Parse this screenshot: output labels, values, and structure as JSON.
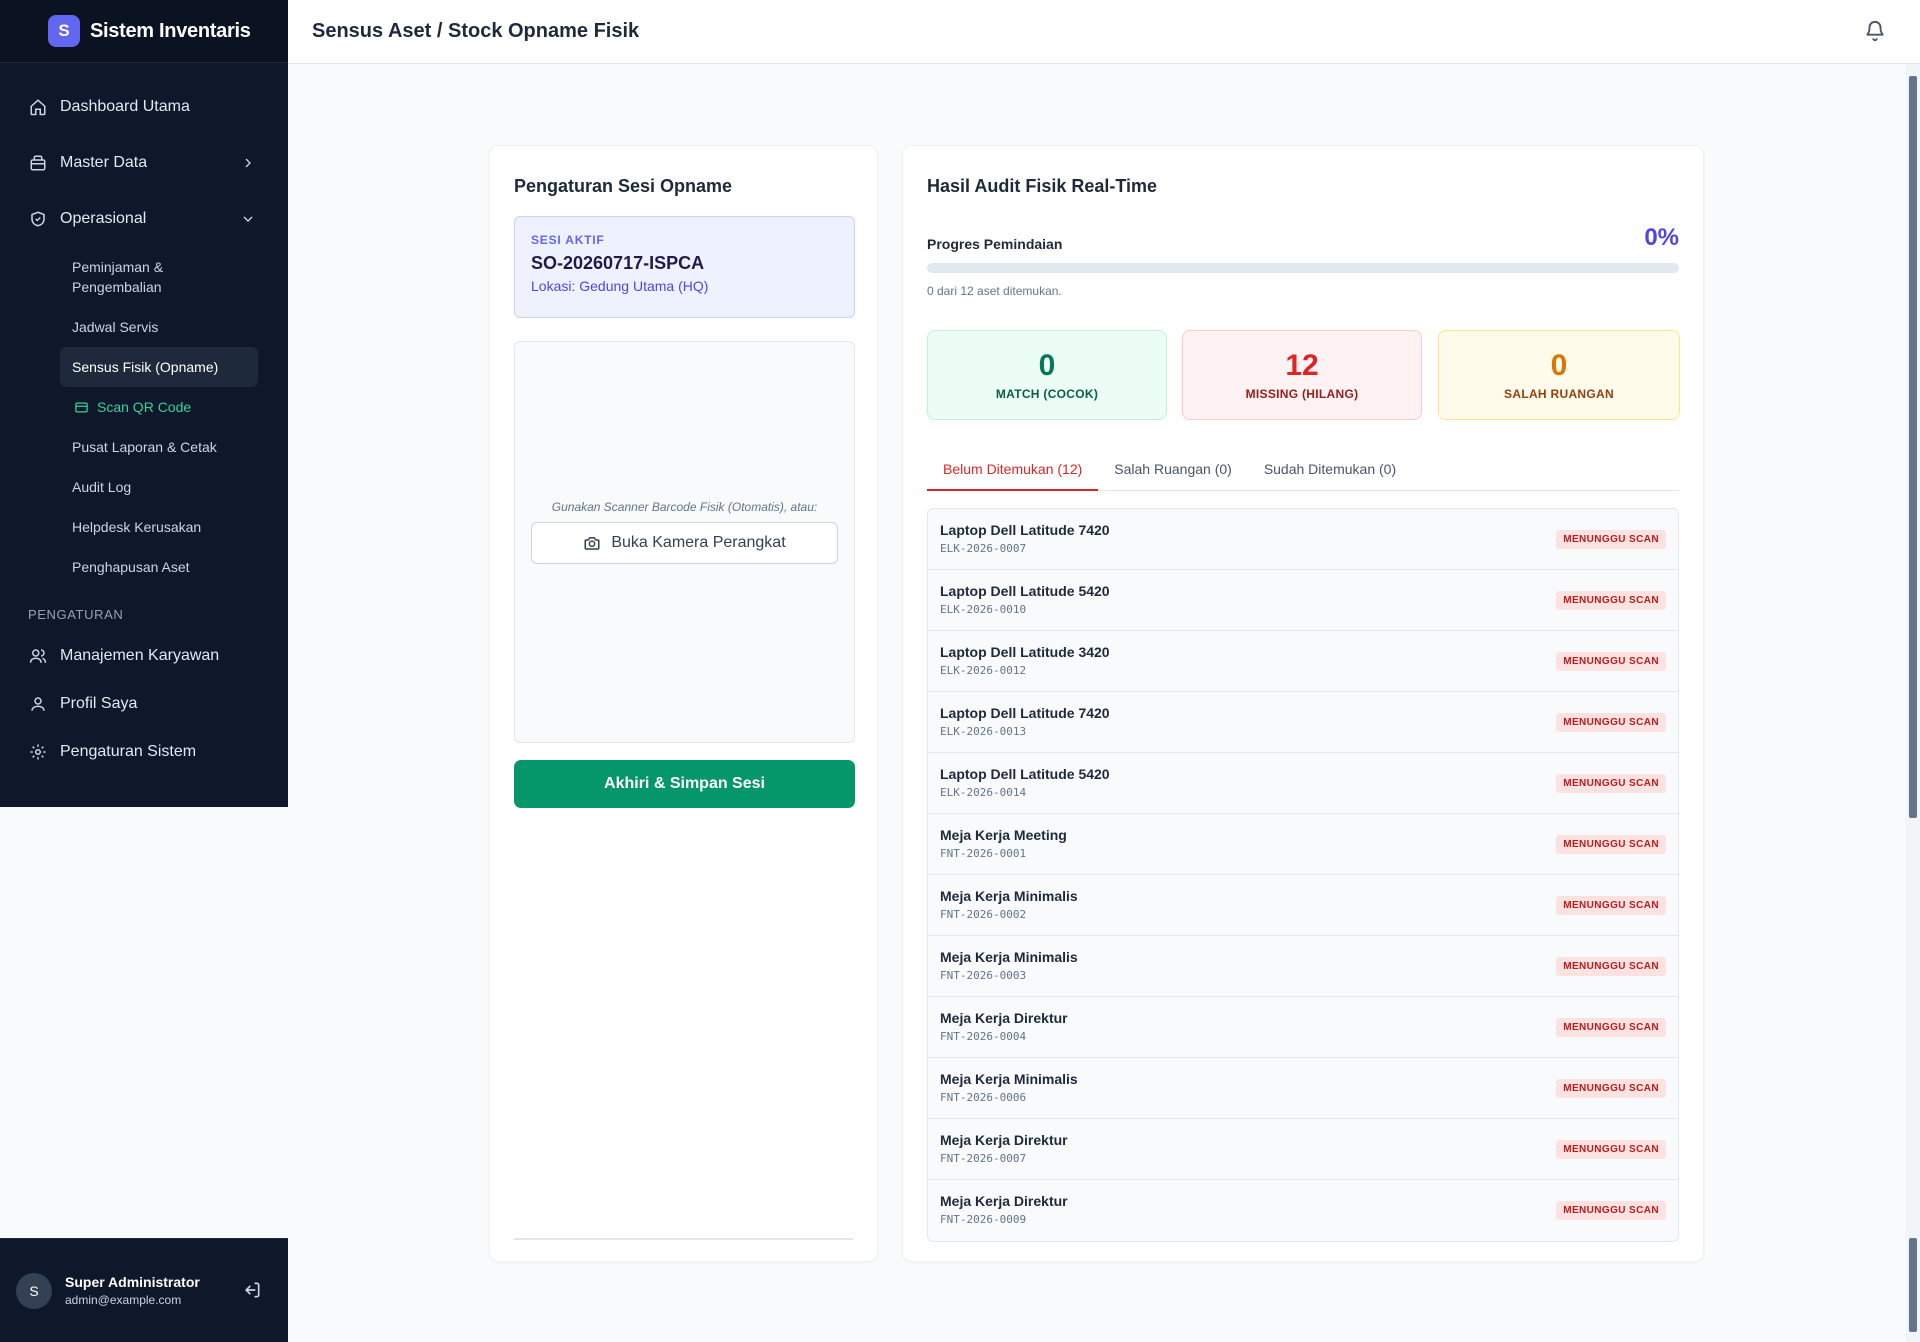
{
  "brand": {
    "logo": "S",
    "name": "Sistem Inventaris"
  },
  "header": {
    "title": "Sensus Aset / Stock Opname Fisik"
  },
  "sidebar": {
    "items": [
      {
        "label": "Dashboard Utama",
        "icon": "home-icon"
      },
      {
        "label": "Master Data",
        "icon": "box-icon"
      },
      {
        "label": "Operasional",
        "icon": "shield-icon"
      }
    ],
    "sub_items": [
      "Peminjaman & Pengembalian",
      "Jadwal Servis",
      "Sensus Fisik (Opname)",
      "Scan QR Code",
      "Pusat Laporan & Cetak",
      "Audit Log",
      "Helpdesk Kerusakan",
      "Penghapusan Aset"
    ],
    "section_label": "PENGATURAN",
    "settings_items": [
      {
        "label": "Manajemen Karyawan",
        "icon": "users-icon"
      },
      {
        "label": "Profil Saya",
        "icon": "user-icon"
      },
      {
        "label": "Pengaturan Sistem",
        "icon": "gear-icon"
      }
    ]
  },
  "user": {
    "initial": "S",
    "name": "Super Administrator",
    "email": "admin@example.com"
  },
  "left_card": {
    "title": "Pengaturan Sesi Opname",
    "session_label": "SESI AKTIF",
    "session_code": "SO-20260717-ISPCA",
    "session_location": "Lokasi: Gedung Utama (HQ)",
    "scanner_hint": "Gunakan Scanner Barcode Fisik (Otomatis), atau:",
    "camera_button": "Buka Kamera Perangkat",
    "save_button": "Akhiri & Simpan Sesi"
  },
  "right_card": {
    "title": "Hasil Audit Fisik Real-Time",
    "progress_label": "Progres Pemindaian",
    "progress_percent": "0%",
    "progress_value": 0,
    "progress_note": "0 dari 12 aset ditemukan.",
    "stats": {
      "match": {
        "value": "0",
        "label": "MATCH (COCOK)"
      },
      "missing": {
        "value": "12",
        "label": "MISSING (HILANG)"
      },
      "wrong": {
        "value": "0",
        "label": "SALAH RUANGAN"
      }
    },
    "tabs": [
      "Belum Ditemukan (12)",
      "Salah Ruangan (0)",
      "Sudah Ditemukan (0)"
    ],
    "assets": [
      {
        "name": "Laptop Dell Latitude 7420",
        "code": "ELK-2026-0007",
        "status": "MENUNGGU SCAN"
      },
      {
        "name": "Laptop Dell Latitude 5420",
        "code": "ELK-2026-0010",
        "status": "MENUNGGU SCAN"
      },
      {
        "name": "Laptop Dell Latitude 3420",
        "code": "ELK-2026-0012",
        "status": "MENUNGGU SCAN"
      },
      {
        "name": "Laptop Dell Latitude 7420",
        "code": "ELK-2026-0013",
        "status": "MENUNGGU SCAN"
      },
      {
        "name": "Laptop Dell Latitude 5420",
        "code": "ELK-2026-0014",
        "status": "MENUNGGU SCAN"
      },
      {
        "name": "Meja Kerja Meeting",
        "code": "FNT-2026-0001",
        "status": "MENUNGGU SCAN"
      },
      {
        "name": "Meja Kerja Minimalis",
        "code": "FNT-2026-0002",
        "status": "MENUNGGU SCAN"
      },
      {
        "name": "Meja Kerja Minimalis",
        "code": "FNT-2026-0003",
        "status": "MENUNGGU SCAN"
      },
      {
        "name": "Meja Kerja Direktur",
        "code": "FNT-2026-0004",
        "status": "MENUNGGU SCAN"
      },
      {
        "name": "Meja Kerja Minimalis",
        "code": "FNT-2026-0006",
        "status": "MENUNGGU SCAN"
      },
      {
        "name": "Meja Kerja Direktur",
        "code": "FNT-2026-0007",
        "status": "MENUNGGU SCAN"
      },
      {
        "name": "Meja Kerja Direktur",
        "code": "FNT-2026-0009",
        "status": "MENUNGGU SCAN"
      }
    ]
  },
  "colors": {
    "sidebar": "#0f172a",
    "accent": "#4f46e5",
    "success": "#059669",
    "danger": "#dc2626",
    "warning": "#d97706"
  }
}
